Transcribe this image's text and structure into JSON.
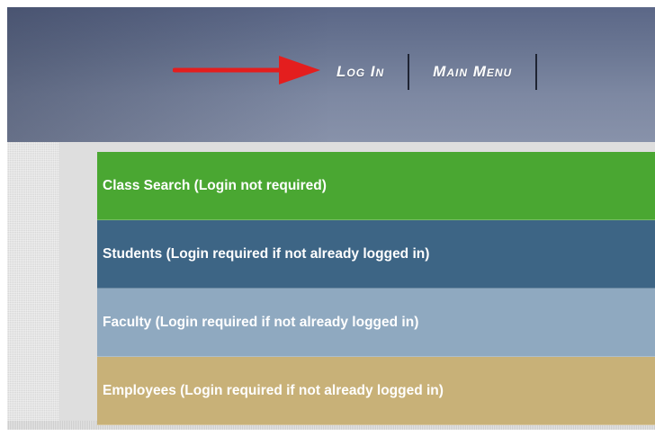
{
  "nav": {
    "items": [
      {
        "label": "Log In"
      },
      {
        "label": "Main Menu"
      }
    ]
  },
  "menu": {
    "items": [
      {
        "label": "Class Search (Login not required)",
        "bg": "#4aa732",
        "color": "#ffffff"
      },
      {
        "label": "Students (Login required if not already logged in)",
        "bg": "#3d6585",
        "color": "#ffffff"
      },
      {
        "label": "Faculty (Login required if not already logged in)",
        "bg": "#8fa9c0",
        "color": "#ffffff"
      },
      {
        "label": "Employees (Login required if not already logged in)",
        "bg": "#c8b178",
        "color": "#ffffff"
      }
    ]
  },
  "annotation": {
    "arrow_color": "#e41e1e",
    "icon": "arrow-right-icon"
  }
}
